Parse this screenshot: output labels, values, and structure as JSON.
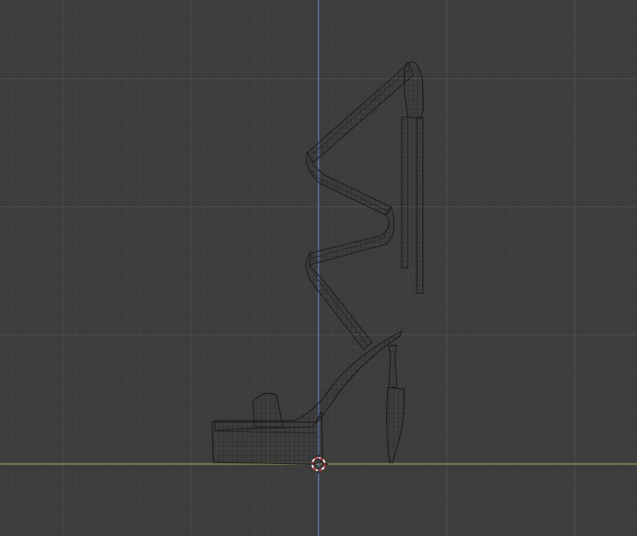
{
  "viewport": {
    "mode": "wireframe",
    "background_color": "#3d3d3d",
    "x_axis_color": "#88a83c",
    "z_axis_color": "#5a7bc7",
    "wire_color": "#1a1a1a"
  },
  "object": {
    "type": "platform-heel-sandal",
    "parts": [
      "platform-sole",
      "toe-strap",
      "foot-bed",
      "spiral-ankle-strap",
      "strap-tails",
      "heel",
      "heel-tip"
    ]
  },
  "cursor_3d": {
    "icon": "3d-cursor-icon",
    "ring_colors": [
      "#e03030",
      "#ffffff"
    ]
  }
}
